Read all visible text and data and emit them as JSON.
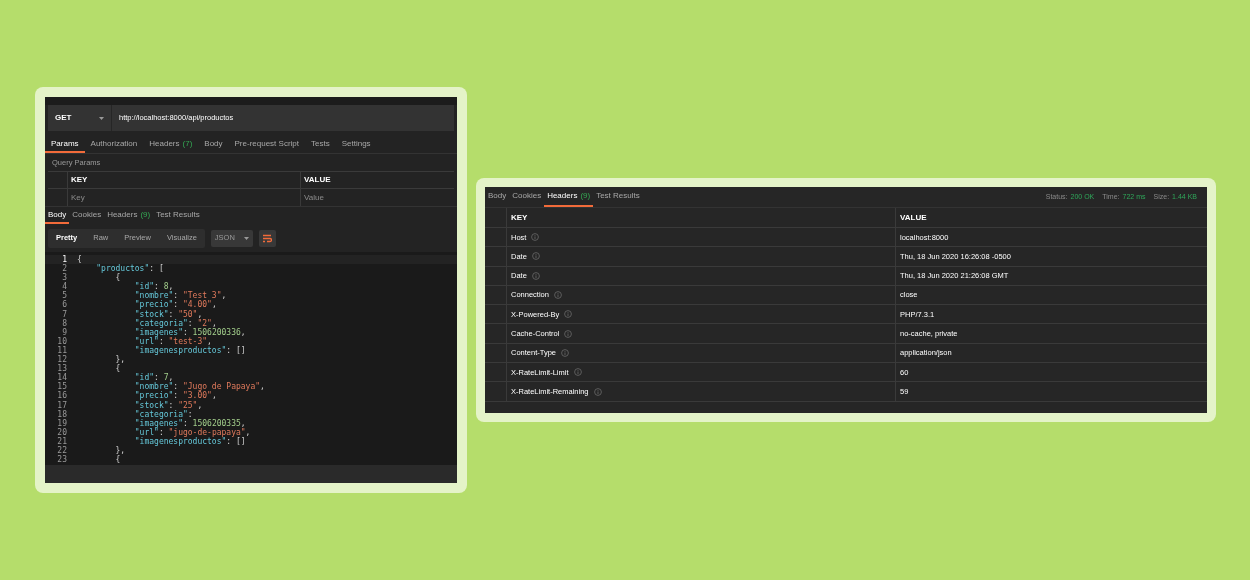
{
  "request_window": {
    "method": "GET",
    "url": "http://localhost:8000/api/productos",
    "request_tabs": [
      {
        "label": "Params",
        "selected": true
      },
      {
        "label": "Authorization",
        "selected": false
      },
      {
        "label": "Headers",
        "count": "(7)",
        "selected": false
      },
      {
        "label": "Body",
        "selected": false
      },
      {
        "label": "Pre-request Script",
        "selected": false
      },
      {
        "label": "Tests",
        "selected": false
      },
      {
        "label": "Settings",
        "selected": false
      }
    ],
    "query_params": {
      "title": "Query Params",
      "columns": [
        "KEY",
        "VALUE"
      ],
      "key_placeholder": "Key",
      "value_placeholder": "Value"
    },
    "response_tabs": [
      {
        "label": "Body",
        "selected": true
      },
      {
        "label": "Cookies",
        "selected": false
      },
      {
        "label": "Headers",
        "count": "(9)",
        "selected": false
      },
      {
        "label": "Test Results",
        "selected": false
      }
    ],
    "view_modes": [
      {
        "label": "Pretty",
        "selected": true
      },
      {
        "label": "Raw",
        "selected": false
      },
      {
        "label": "Preview",
        "selected": false
      },
      {
        "label": "Visualize",
        "selected": false
      }
    ],
    "format": "JSON",
    "code_lines": [
      {
        "number": "1",
        "tokens": [
          {
            "kind": "punct",
            "text": "{"
          }
        ]
      },
      {
        "number": "2",
        "tokens": [
          {
            "kind": "key",
            "text": "    \"productos\""
          },
          {
            "kind": "punct",
            "text": ": ["
          }
        ]
      },
      {
        "number": "3",
        "tokens": [
          {
            "kind": "punct",
            "text": "        {"
          }
        ]
      },
      {
        "number": "4",
        "tokens": [
          {
            "kind": "key",
            "text": "            \"id\""
          },
          {
            "kind": "punct",
            "text": ": "
          },
          {
            "kind": "number",
            "text": "8"
          },
          {
            "kind": "punct",
            "text": ","
          }
        ]
      },
      {
        "number": "5",
        "tokens": [
          {
            "kind": "key",
            "text": "            \"nombre\""
          },
          {
            "kind": "punct",
            "text": ": "
          },
          {
            "kind": "string",
            "text": "\"Test 3\""
          },
          {
            "kind": "punct",
            "text": ","
          }
        ]
      },
      {
        "number": "6",
        "tokens": [
          {
            "kind": "key",
            "text": "            \"precio\""
          },
          {
            "kind": "punct",
            "text": ": "
          },
          {
            "kind": "string",
            "text": "\"4.00\""
          },
          {
            "kind": "punct",
            "text": ","
          }
        ]
      },
      {
        "number": "7",
        "tokens": [
          {
            "kind": "key",
            "text": "            \"stock\""
          },
          {
            "kind": "punct",
            "text": ": "
          },
          {
            "kind": "string",
            "text": "\"50\""
          },
          {
            "kind": "punct",
            "text": ","
          }
        ]
      },
      {
        "number": "8",
        "tokens": [
          {
            "kind": "key",
            "text": "            \"categoria\""
          },
          {
            "kind": "punct",
            "text": ": "
          },
          {
            "kind": "string",
            "text": "\"2\""
          },
          {
            "kind": "punct",
            "text": ","
          }
        ]
      },
      {
        "number": "9",
        "tokens": [
          {
            "kind": "key",
            "text": "            \"imagenes\""
          },
          {
            "kind": "punct",
            "text": ": "
          },
          {
            "kind": "number",
            "text": "1506200336"
          },
          {
            "kind": "punct",
            "text": ","
          }
        ]
      },
      {
        "number": "10",
        "tokens": [
          {
            "kind": "key",
            "text": "            \"url\""
          },
          {
            "kind": "punct",
            "text": ": "
          },
          {
            "kind": "string",
            "text": "\"test-3\""
          },
          {
            "kind": "punct",
            "text": ","
          }
        ]
      },
      {
        "number": "11",
        "tokens": [
          {
            "kind": "key",
            "text": "            \"imagenesproductos\""
          },
          {
            "kind": "punct",
            "text": ": []"
          }
        ]
      },
      {
        "number": "12",
        "tokens": [
          {
            "kind": "punct",
            "text": "        },"
          }
        ]
      },
      {
        "number": "13",
        "tokens": [
          {
            "kind": "punct",
            "text": "        {"
          }
        ]
      },
      {
        "number": "14",
        "tokens": [
          {
            "kind": "key",
            "text": "            \"id\""
          },
          {
            "kind": "punct",
            "text": ": "
          },
          {
            "kind": "number",
            "text": "7"
          },
          {
            "kind": "punct",
            "text": ","
          }
        ]
      },
      {
        "number": "15",
        "tokens": [
          {
            "kind": "key",
            "text": "            \"nombre\""
          },
          {
            "kind": "punct",
            "text": ": "
          },
          {
            "kind": "string",
            "text": "\"Jugo de Papaya\""
          },
          {
            "kind": "punct",
            "text": ","
          }
        ]
      },
      {
        "number": "16",
        "tokens": [
          {
            "kind": "key",
            "text": "            \"precio\""
          },
          {
            "kind": "punct",
            "text": ": "
          },
          {
            "kind": "string",
            "text": "\"3.00\""
          },
          {
            "kind": "punct",
            "text": ","
          }
        ]
      },
      {
        "number": "17",
        "tokens": [
          {
            "kind": "key",
            "text": "            \"stock\""
          },
          {
            "kind": "punct",
            "text": ": "
          },
          {
            "kind": "string",
            "text": "\"25\""
          },
          {
            "kind": "punct",
            "text": ","
          }
        ]
      },
      {
        "number": "18",
        "tokens": [
          {
            "kind": "key",
            "text": "            \"categoria\""
          },
          {
            "kind": "punct",
            "text": ":"
          }
        ]
      },
      {
        "number": "19",
        "tokens": [
          {
            "kind": "key",
            "text": "            \"imagenes\""
          },
          {
            "kind": "punct",
            "text": ": "
          },
          {
            "kind": "number",
            "text": "1506200335"
          },
          {
            "kind": "punct",
            "text": ","
          }
        ]
      },
      {
        "number": "20",
        "tokens": [
          {
            "kind": "key",
            "text": "            \"url\""
          },
          {
            "kind": "punct",
            "text": ": "
          },
          {
            "kind": "string",
            "text": "\"jugo-de-papaya\""
          },
          {
            "kind": "punct",
            "text": ","
          }
        ]
      },
      {
        "number": "21",
        "tokens": [
          {
            "kind": "key",
            "text": "            \"imagenesproductos\""
          },
          {
            "kind": "punct",
            "text": ": []"
          }
        ]
      },
      {
        "number": "22",
        "tokens": [
          {
            "kind": "punct",
            "text": "        },"
          }
        ]
      },
      {
        "number": "23",
        "tokens": [
          {
            "kind": "punct",
            "text": "        {"
          }
        ]
      }
    ]
  },
  "response_window": {
    "tabs": [
      {
        "label": "Body",
        "selected": false
      },
      {
        "label": "Cookies",
        "selected": false
      },
      {
        "label": "Headers",
        "count": "(9)",
        "selected": true
      },
      {
        "label": "Test Results",
        "selected": false
      }
    ],
    "status": {
      "status_label": "Status:",
      "status_value": "200 OK",
      "time_label": "Time:",
      "time_value": "722 ms",
      "size_label": "Size:",
      "size_value": "1.44 KB"
    },
    "columns": [
      "KEY",
      "VALUE"
    ],
    "headers": [
      {
        "key": "Host",
        "value": "localhost:8000"
      },
      {
        "key": "Date",
        "value": "Thu, 18 Jun 2020 16:26:08 -0500"
      },
      {
        "key": "Date",
        "value": "Thu, 18 Jun 2020 21:26:08 GMT"
      },
      {
        "key": "Connection",
        "value": "close"
      },
      {
        "key": "X-Powered-By",
        "value": "PHP/7.3.1"
      },
      {
        "key": "Cache-Control",
        "value": "no-cache, private"
      },
      {
        "key": "Content-Type",
        "value": "application/json"
      },
      {
        "key": "X-RateLimit-Limit",
        "value": "60"
      },
      {
        "key": "X-RateLimit-Remaining",
        "value": "59"
      }
    ]
  }
}
